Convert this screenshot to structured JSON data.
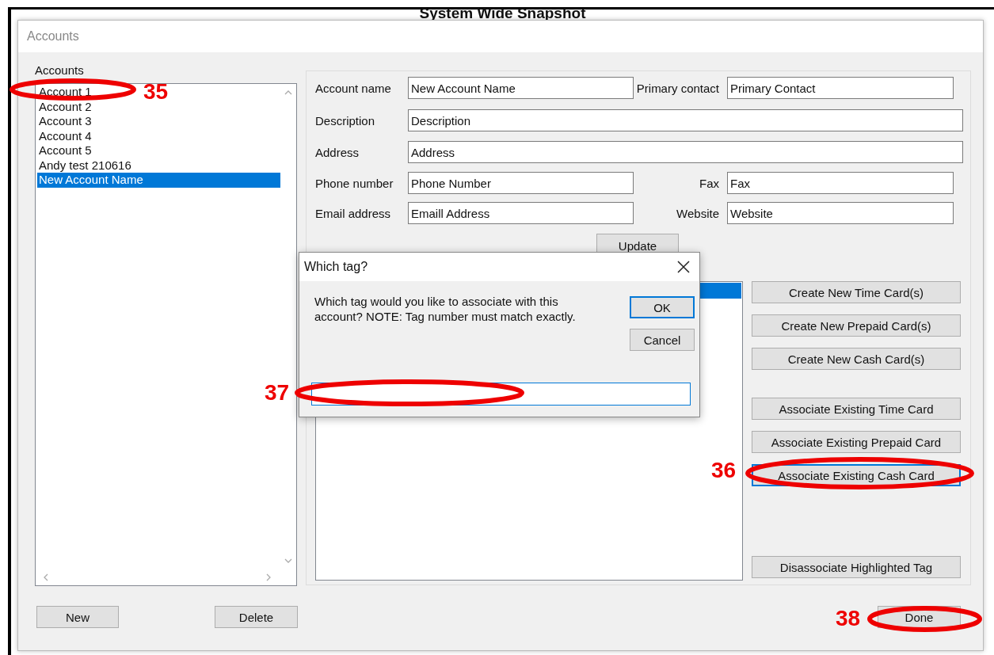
{
  "background_heading": "System Wide Snapshot",
  "window": {
    "title": "Accounts"
  },
  "accounts": {
    "label": "Accounts",
    "items": [
      {
        "name": "Account 1",
        "selected": false
      },
      {
        "name": "Account 2",
        "selected": false
      },
      {
        "name": "Account 3",
        "selected": false
      },
      {
        "name": "Account 4",
        "selected": false
      },
      {
        "name": "Account 5",
        "selected": false
      },
      {
        "name": "Andy test 210616",
        "selected": false
      },
      {
        "name": "New Account Name",
        "selected": true
      }
    ]
  },
  "form": {
    "rows": [
      [
        {
          "label": "Account name",
          "value": "New Account Name"
        },
        {
          "label": "Primary contact",
          "value": "Primary Contact"
        }
      ],
      [
        {
          "label": "Description",
          "value": "Description"
        }
      ],
      [
        {
          "label": "Address",
          "value": "Address"
        }
      ],
      [
        {
          "label": "Phone number",
          "value": "Phone Number"
        },
        {
          "label": "Fax",
          "value": "Fax"
        }
      ],
      [
        {
          "label": "Email address",
          "value": "Emaill Address"
        },
        {
          "label": "Website",
          "value": "Website"
        }
      ]
    ],
    "update_button": "Update"
  },
  "tag_list": {
    "rows": [
      {
        "selected": true
      }
    ]
  },
  "card_buttons": [
    [
      {
        "label": "Create New Time Card(s)",
        "focused": false
      },
      {
        "label": "Create New Prepaid Card(s)",
        "focused": false
      },
      {
        "label": "Create New Cash Card(s)",
        "focused": false
      }
    ],
    [
      {
        "label": "Associate Existing Time Card",
        "focused": false
      },
      {
        "label": "Associate Existing Prepaid Card",
        "focused": false
      },
      {
        "label": "Associate Existing Cash Card",
        "focused": true
      }
    ],
    [
      {
        "label": "Disassociate Highlighted Tag",
        "focused": false
      }
    ]
  ],
  "bottom_buttons": {
    "left": [
      "New",
      "Delete"
    ],
    "right": "Done"
  },
  "dialog": {
    "title": "Which tag?",
    "message": "Which tag would you like to associate with this account?  NOTE:  Tag number must match exactly.",
    "buttons": [
      {
        "label": "OK",
        "focused": true
      },
      {
        "label": "Cancel",
        "focused": false
      }
    ]
  },
  "annotations": [
    {
      "number": "35"
    },
    {
      "number": "37"
    },
    {
      "number": "36"
    },
    {
      "number": "38"
    }
  ]
}
